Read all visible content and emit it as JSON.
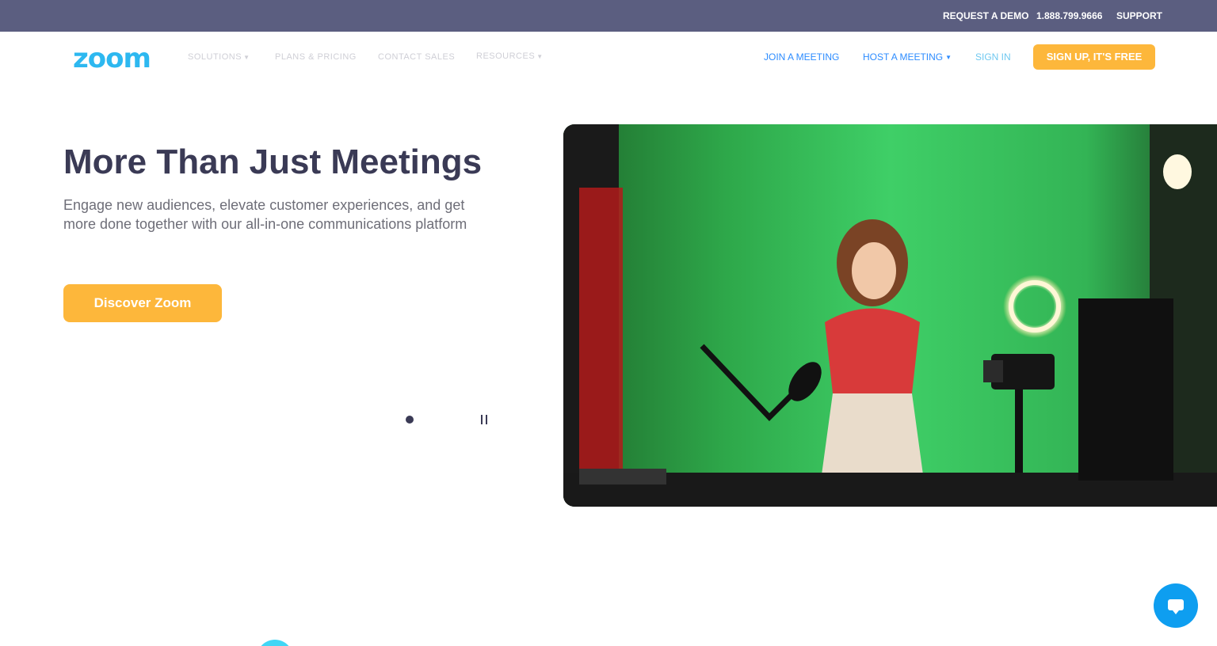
{
  "topbar": {
    "request_demo": "REQUEST A DEMO",
    "phone": "1.888.799.9666",
    "support": "SUPPORT"
  },
  "nav": {
    "logo": "zoom",
    "solutions": "SOLUTIONS",
    "plans": "PLANS & PRICING",
    "contact_sales": "CONTACT SALES",
    "resources": "RESOURCES",
    "join_meeting": "JOIN A MEETING",
    "host_meeting": "HOST A MEETING",
    "sign_in": "SIGN IN",
    "sign_up": "SIGN UP, IT'S FREE"
  },
  "hero": {
    "title": "More Than Just Meetings",
    "subtitle": "Engage new audiences, elevate customer experiences, and get more done together with our all-in-one communications platform",
    "cta": "Discover Zoom"
  },
  "colors": {
    "topbar": "#5b5e80",
    "brand_blue": "#2d8cff",
    "accent_orange": "#fdb73b",
    "heading": "#3a3a55"
  },
  "icons": {
    "chat": "chat-bubble-icon",
    "pause": "pause-icon",
    "caret": "caret-down-icon"
  }
}
